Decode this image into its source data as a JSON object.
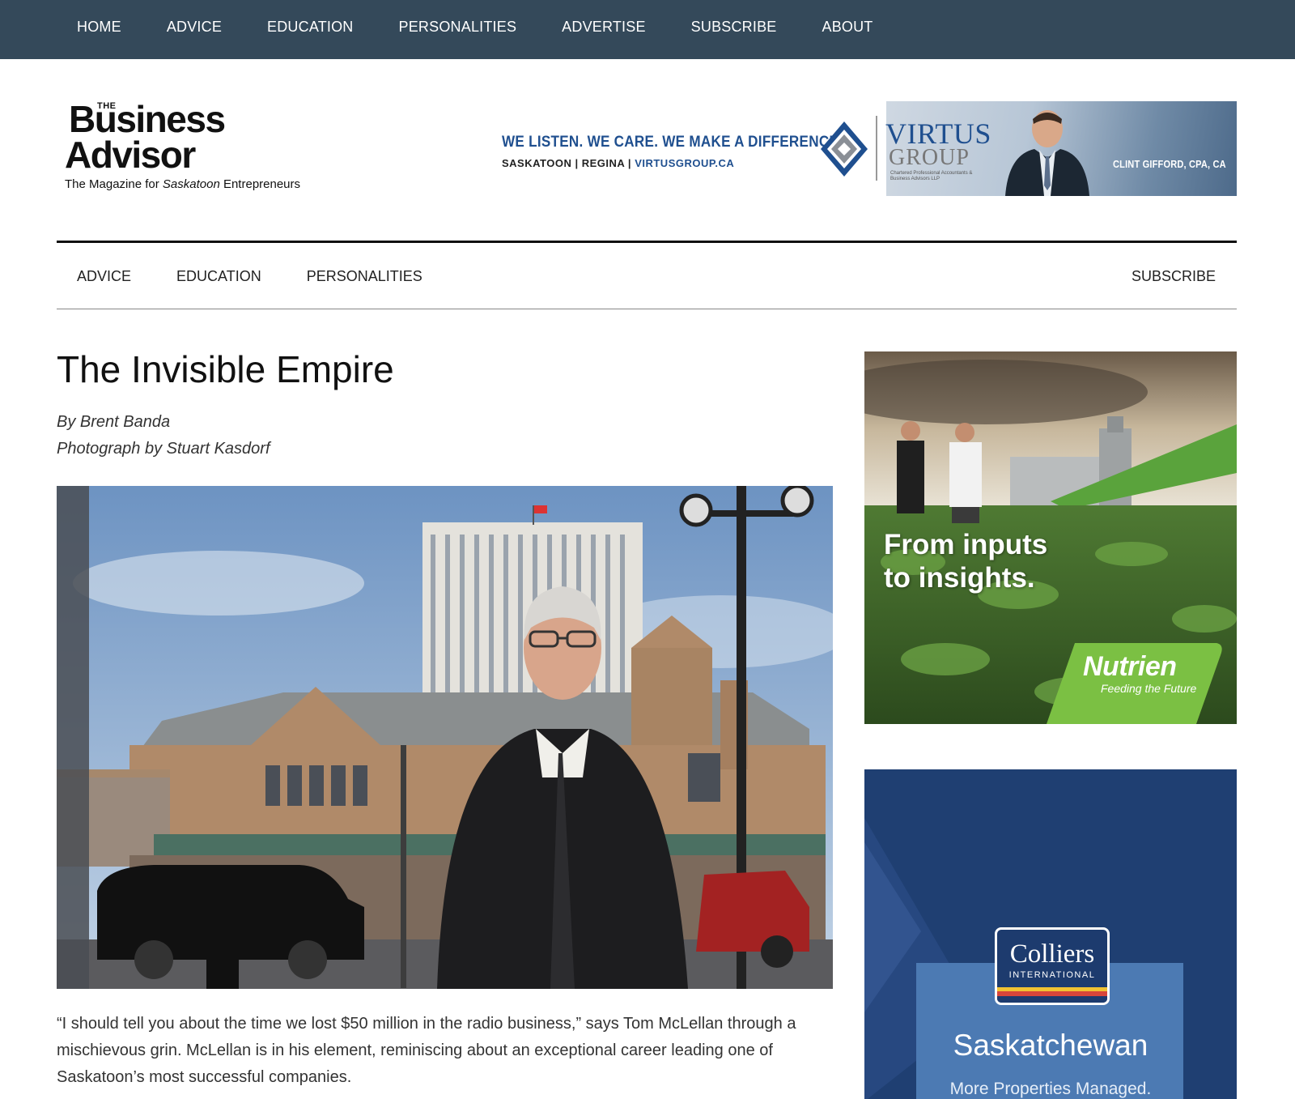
{
  "top_nav": [
    "HOME",
    "ADVICE",
    "EDUCATION",
    "PERSONALITIES",
    "ADVERTISE",
    "SUBSCRIBE",
    "ABOUT"
  ],
  "logo": {
    "the": "THE",
    "line1": "Business",
    "line2": "Advisor",
    "tagline_pre": "The Magazine for ",
    "tagline_italic": "Saskatoon",
    "tagline_post": " Entrepreneurs"
  },
  "banner_ad": {
    "slogan": "WE LISTEN. WE CARE. WE MAKE A DIFFERENCE.",
    "city1": "SASKATOON",
    "city2": "REGINA",
    "site": "VIRTUSGROUP.CA",
    "brand1": "VIRTUS",
    "brand2": "GROUP",
    "brand_small": "Chartered Professional Accountants & Business Advisors LLP",
    "person": "CLINT GIFFORD, CPA, CA"
  },
  "sec_nav": [
    "ADVICE",
    "EDUCATION",
    "PERSONALITIES"
  ],
  "sec_nav_right": "SUBSCRIBE",
  "article": {
    "title": "The Invisible Empire",
    "author": "By Brent Banda",
    "photo_credit": "Photograph by Stuart Kasdorf",
    "paragraph": "“I should tell you about the time we lost $50 million in the radio business,” says Tom McLellan through a mischievous grin. McLellan is in his element, reminiscing about an exceptional career leading one of Saskatoon’s most successful companies."
  },
  "sidebar_ad1": {
    "headline1": "From inputs",
    "headline2": "to insights.",
    "brand": "Nutrien",
    "brand_tag": "Feeding the Future"
  },
  "sidebar_ad2": {
    "brand": "Colliers",
    "brand_sub": "INTERNATIONAL",
    "region": "Saskatchewan",
    "tagline": "More Properties Managed."
  },
  "colors": {
    "top_nav_bg": "#34495a",
    "banner_blue": "#1f4f8f",
    "nutrien_green": "#7bc043",
    "colliers_navy": "#1f3f72"
  }
}
